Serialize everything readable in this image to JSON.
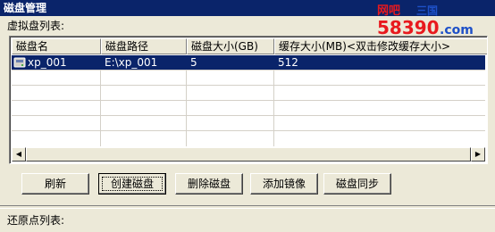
{
  "window": {
    "title": "磁盘管理"
  },
  "watermark": {
    "line1": "网吧",
    "line2": "58390",
    "suffix": ".com",
    "corner": "三国"
  },
  "virtual_disks": {
    "label": "虚拟盘列表:",
    "columns": [
      "磁盘名",
      "磁盘路径",
      "磁盘大小(GB)",
      "缓存大小(MB)<双击修改缓存大小>"
    ],
    "rows": [
      {
        "name": "xp_001",
        "path": "E:\\xp_001",
        "size": "5",
        "cache": "512",
        "icon": "disk-icon",
        "selected": true
      }
    ]
  },
  "buttons": {
    "refresh": "刷新",
    "create": "创建磁盘",
    "delete": "删除磁盘",
    "add_mirror": "添加镜像",
    "sync": "磁盘同步"
  },
  "restore_points": {
    "label": "还原点列表:"
  },
  "colors": {
    "selection": "#0a246a",
    "titlebar": "#0a246a",
    "face": "#ece9d8",
    "watermark_red": "#e8191e",
    "watermark_blue": "#1e50c8"
  }
}
